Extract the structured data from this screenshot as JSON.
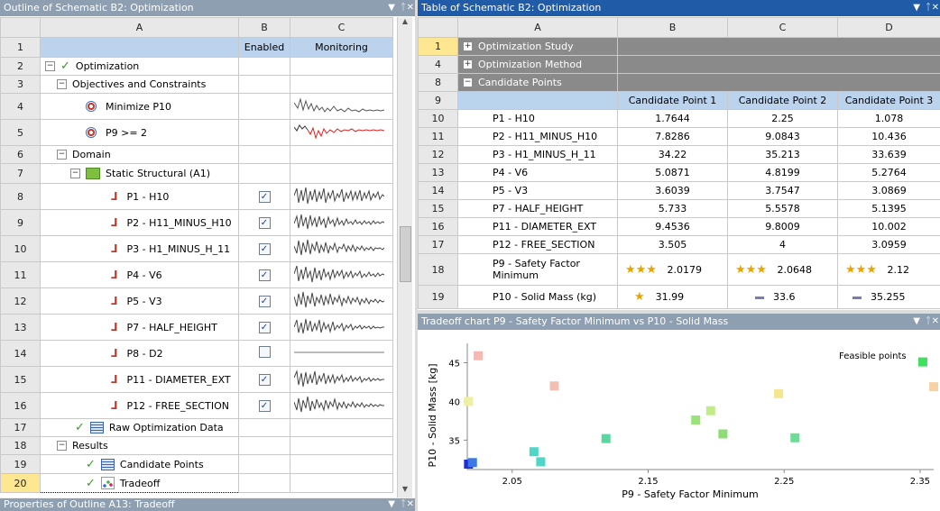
{
  "outline": {
    "title": "Outline of Schematic B2: Optimization",
    "col_a": "A",
    "col_b": "B",
    "col_c": "C",
    "enabled_label": "Enabled",
    "monitoring_label": "Monitoring",
    "rows": [
      {
        "num": "1"
      },
      {
        "num": "2",
        "label": "Optimization"
      },
      {
        "num": "3",
        "label": "Objectives and Constraints"
      },
      {
        "num": "4",
        "label": "Minimize P10"
      },
      {
        "num": "5",
        "label": "P9 >= 2"
      },
      {
        "num": "6",
        "label": "Domain"
      },
      {
        "num": "7",
        "label": "Static Structural (A1)"
      },
      {
        "num": "8",
        "label": "P1 - H10",
        "checked": true
      },
      {
        "num": "9",
        "label": "P2 - H11_MINUS_H10",
        "checked": true
      },
      {
        "num": "10",
        "label": "P3 - H1_MINUS_H_11",
        "checked": true
      },
      {
        "num": "11",
        "label": "P4 - V6",
        "checked": true
      },
      {
        "num": "12",
        "label": "P5 - V3",
        "checked": true
      },
      {
        "num": "13",
        "label": "P7 - HALF_HEIGHT",
        "checked": true
      },
      {
        "num": "14",
        "label": "P8 - D2",
        "checked": false
      },
      {
        "num": "15",
        "label": "P11 - DIAMETER_EXT",
        "checked": true
      },
      {
        "num": "16",
        "label": "P12 - FREE_SECTION",
        "checked": true
      },
      {
        "num": "17",
        "label": "Raw Optimization Data"
      },
      {
        "num": "18",
        "label": "Results"
      },
      {
        "num": "19",
        "label": "Candidate Points"
      },
      {
        "num": "20",
        "label": "Tradeoff"
      }
    ]
  },
  "properties": {
    "title": "Properties of Outline A13: Tradeoff"
  },
  "table": {
    "title": "Table of Schematic B2: Optimization",
    "cols": [
      "A",
      "B",
      "C",
      "D"
    ],
    "sections": [
      {
        "num": "1",
        "label": "Optimization Study"
      },
      {
        "num": "4",
        "label": "Optimization Method"
      },
      {
        "num": "8",
        "label": "Candidate Points"
      }
    ],
    "header_num": "9",
    "candidates": [
      "Candidate Point 1",
      "Candidate Point 2",
      "Candidate Point 3"
    ],
    "rows": [
      {
        "num": "10",
        "label": "P1 - H10",
        "v": [
          "1.7644",
          "2.25",
          "1.078"
        ]
      },
      {
        "num": "11",
        "label": "P2 - H11_MINUS_H10",
        "v": [
          "7.8286",
          "9.0843",
          "10.436"
        ]
      },
      {
        "num": "12",
        "label": "P3 - H1_MINUS_H_11",
        "v": [
          "34.22",
          "35.213",
          "33.639"
        ]
      },
      {
        "num": "13",
        "label": "P4 - V6",
        "v": [
          "5.0871",
          "4.8199",
          "5.2764"
        ]
      },
      {
        "num": "14",
        "label": "P5 - V3",
        "v": [
          "3.6039",
          "3.7547",
          "3.0869"
        ]
      },
      {
        "num": "15",
        "label": "P7 - HALF_HEIGHT",
        "v": [
          "5.733",
          "5.5578",
          "5.1395"
        ]
      },
      {
        "num": "16",
        "label": "P11 - DIAMETER_EXT",
        "v": [
          "9.4536",
          "9.8009",
          "10.002"
        ]
      },
      {
        "num": "17",
        "label": "P12 - FREE_SECTION",
        "v": [
          "3.505",
          "4",
          "3.0959"
        ]
      }
    ],
    "safety": {
      "num": "18",
      "label_1": "P9 - Safety Factor",
      "label_2": "Minimum",
      "v": [
        "2.0179",
        "2.0648",
        "2.12"
      ],
      "stars": [
        "★★★",
        "★★★",
        "★★★"
      ]
    },
    "mass": {
      "num": "19",
      "label": "P10 - Solid Mass (kg)",
      "v": [
        "31.99",
        "33.6",
        "35.255"
      ],
      "stars": [
        "★",
        "",
        ""
      ]
    }
  },
  "chart_panel": {
    "title": "Tradeoff chart P9 - Safety Factor Minimum vs P10 - Solid Mass"
  },
  "chart_data": {
    "type": "scatter",
    "xlabel": "P9 - Safety Factor Minimum",
    "ylabel": "P10 - Solid Mass  [kg]",
    "legend": "Feasible points",
    "xlim": [
      2.017,
      2.36
    ],
    "ylim": [
      31.2,
      47.5
    ],
    "xticks": [
      2.05,
      2.15,
      2.25,
      2.35
    ],
    "xtick_labels": [
      "2.05",
      "2.15",
      "2.25",
      "2.35"
    ],
    "yticks": [
      35,
      40,
      45
    ],
    "ytick_labels": [
      "35",
      "40",
      "45"
    ],
    "points": [
      {
        "x": 2.0179,
        "y": 31.9,
        "color": "#1e2fd6"
      },
      {
        "x": 2.0208,
        "y": 32.1,
        "color": "#3a79e6"
      },
      {
        "x": 2.066,
        "y": 33.5,
        "color": "#4fd6c6"
      },
      {
        "x": 2.071,
        "y": 32.2,
        "color": "#4fd6c6"
      },
      {
        "x": 2.119,
        "y": 35.2,
        "color": "#5cd6a0"
      },
      {
        "x": 2.185,
        "y": 37.6,
        "color": "#9ae27a"
      },
      {
        "x": 2.196,
        "y": 38.8,
        "color": "#c2ec8a"
      },
      {
        "x": 2.205,
        "y": 35.8,
        "color": "#8edc76"
      },
      {
        "x": 2.258,
        "y": 35.3,
        "color": "#6cdc96"
      },
      {
        "x": 2.246,
        "y": 41.0,
        "color": "#f4e68e"
      },
      {
        "x": 2.0179,
        "y": 40.0,
        "color": "#eef0a0"
      },
      {
        "x": 2.025,
        "y": 45.9,
        "color": "#f6b8b0"
      },
      {
        "x": 2.081,
        "y": 42.0,
        "color": "#f2c0b0"
      },
      {
        "x": 2.352,
        "y": 45.1,
        "color": "#3fe060"
      },
      {
        "x": 2.36,
        "y": 41.9,
        "color": "#f6d2a6"
      }
    ]
  }
}
